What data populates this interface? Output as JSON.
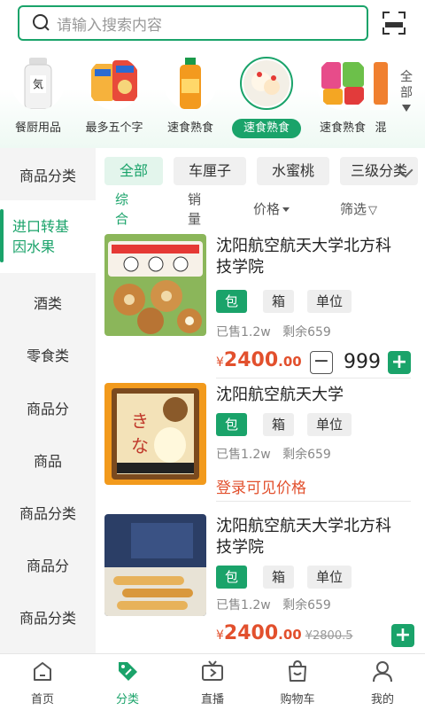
{
  "search": {
    "placeholder": "请输入搜索内容"
  },
  "category_strip": {
    "items": [
      {
        "label": "餐厨用品",
        "active": false
      },
      {
        "label": "最多五个字",
        "active": false
      },
      {
        "label": "速食熟食",
        "active": false
      },
      {
        "label": "速食熟食",
        "active": true
      },
      {
        "label": "速食熟食",
        "active": false
      },
      {
        "label": "混",
        "active": false
      }
    ],
    "all_label_1": "全",
    "all_label_2": "部"
  },
  "sidebar": {
    "items": [
      {
        "label": "商品分类"
      },
      {
        "label_1": "进口转基",
        "label_2": "因水果",
        "active": true
      },
      {
        "label": "酒类"
      },
      {
        "label": "零食类"
      },
      {
        "label": "商品分"
      },
      {
        "label": "商品"
      },
      {
        "label": "商品分类"
      },
      {
        "label": "商品分"
      },
      {
        "label": "商品分类"
      }
    ]
  },
  "filter_tags": [
    "全部",
    "车厘子",
    "水蜜桃",
    "三级分类"
  ],
  "sort": {
    "comprehensive_1": "综",
    "comprehensive_2": "合",
    "sales_1": "销",
    "sales_2": "量",
    "price": "价格",
    "filter": "筛选"
  },
  "products": [
    {
      "name_1": "沈阳航空航天大学北方科",
      "name_2": "技学院",
      "units": [
        "包",
        "箱",
        "单位"
      ],
      "sold": "已售1.2w",
      "stock": "剩余659",
      "currency": "¥",
      "price_int": "2400",
      "price_dec": ".00",
      "quantity": "999"
    },
    {
      "name_1": "沈阳航空航天大学",
      "units": [
        "包",
        "箱",
        "单位"
      ],
      "sold": "已售1.2w",
      "stock": "剩余659",
      "login_text": "登录可见价格"
    },
    {
      "name_1": "沈阳航空航天大学北方科",
      "name_2": "技学院",
      "units": [
        "包",
        "箱",
        "单位"
      ],
      "sold": "已售1.2w",
      "stock": "剩余659",
      "currency": "¥",
      "price_int": "2400",
      "price_dec": ".00",
      "original_price": "¥2800.5"
    }
  ],
  "tabbar": {
    "items": [
      {
        "label": "首页",
        "icon": "home-icon"
      },
      {
        "label": "分类",
        "icon": "tag-icon",
        "active": true
      },
      {
        "label": "直播",
        "icon": "tv-icon"
      },
      {
        "label": "购物车",
        "icon": "bag-icon"
      },
      {
        "label": "我的",
        "icon": "user-icon"
      }
    ]
  },
  "colors": {
    "accent": "#1aa36a",
    "price": "#e2502d"
  }
}
